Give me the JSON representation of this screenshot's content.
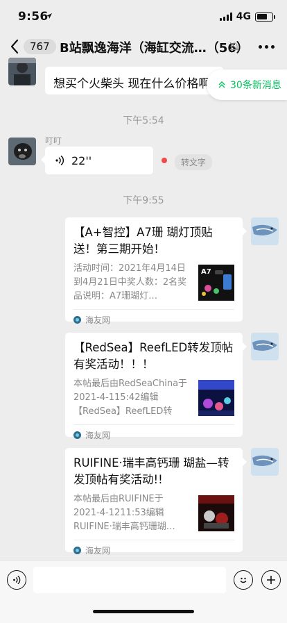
{
  "status_bar": {
    "time": "9:56",
    "network": "4G"
  },
  "nav": {
    "unread_count": "767",
    "title": "B站飘逸海洋（海缸交流…（56）"
  },
  "new_messages": {
    "label": "30条新消息"
  },
  "messages": [
    {
      "sender": "",
      "text": "想买个火柴头  现在什么价格啊"
    },
    {
      "timestamp": "下午5:54"
    },
    {
      "sender": "叮叮",
      "voice_duration": "22''",
      "convert_label": "转文字"
    },
    {
      "timestamp": "下午9:55"
    }
  ],
  "cards": [
    {
      "title": "【A+智控】A7珊 瑚灯顶贴送！第三期开始！",
      "desc": "活动时间：2021年4月14日到4月21日中奖人数：2名奖品说明：A7珊瑚灯…",
      "source": "海友网",
      "thumb_text": "A7"
    },
    {
      "title": "【RedSea】ReefLED转发顶帖有奖活动！！！",
      "desc": "本帖最后由RedSeaChina于2021-4-115:42编辑【RedSea】ReefLED转发…",
      "source": "海友网"
    },
    {
      "title": "RUIFINE·瑞丰高钙珊 瑚盐—转发顶帖有奖活动!!",
      "desc": "本帖最后由RUIFINE于2021-4-1211:53编辑RUIFINE·瑞丰高钙珊瑚…",
      "source": "海友网"
    }
  ],
  "input": {
    "placeholder": ""
  },
  "colors": {
    "accent": "#07c160",
    "background": "#ededed",
    "unread_dot": "#f04a4a"
  }
}
